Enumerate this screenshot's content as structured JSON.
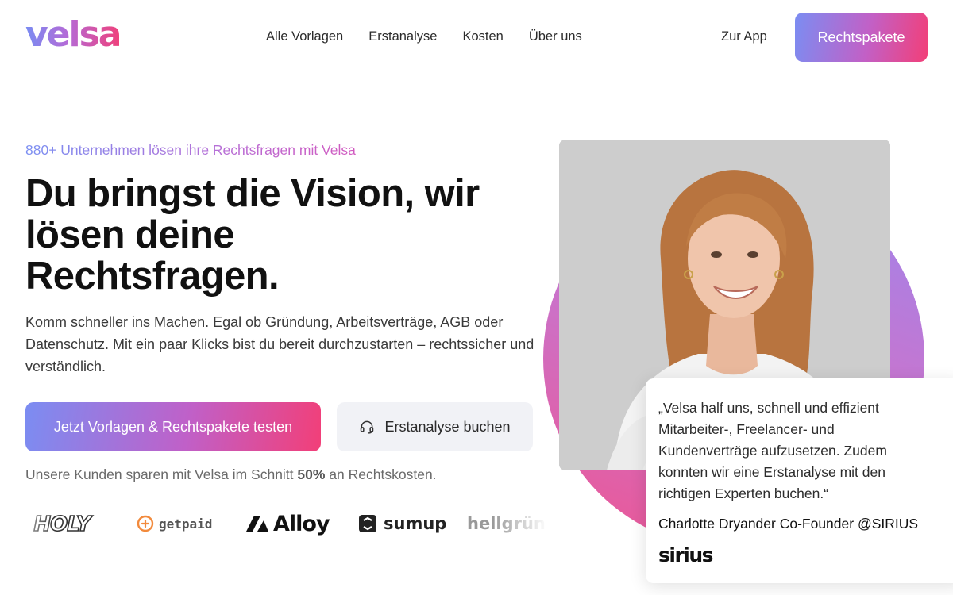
{
  "brand": {
    "name": "velsa"
  },
  "nav": {
    "links": [
      "Alle Vorlagen",
      "Erstanalyse",
      "Kosten",
      "Über uns"
    ],
    "app_link": "Zur App",
    "cta": "Rechtspakete"
  },
  "hero": {
    "eyebrow": "880+ Unternehmen lösen ihre Rechtsfragen mit Velsa",
    "headline_1": "Du bringst die Vision, wir",
    "headline_2": "lösen deine",
    "headline_3": "Rechtsfragen.",
    "subtext": "Komm schneller ins Machen. Egal ob Gründung, Arbeitsverträge, AGB oder Datenschutz. Mit ein paar Klicks bist du bereit durchzustarten – rechtssicher und verständlich.",
    "primary_button": "Jetzt Vorlagen & Rechtspakete testen",
    "secondary_button": "Erstanalyse buchen",
    "savings_prefix": "Unsere Kunden sparen mit Velsa im Schnitt",
    "savings_value": "50%",
    "savings_suffix": "an Rechtskosten."
  },
  "logos": {
    "holy": "HOLY",
    "getpaid": "getpaid",
    "alloy": "Alloy",
    "sumup": "sumup",
    "hellgruen": "hellgrün"
  },
  "testimonial": {
    "quote": "„Velsa half uns, schnell und effizient Mitarbeiter-, Freelancer- und Kundenverträge aufzusetzen. Zudem konnten wir eine Erstanalyse mit den richtigen Experten buchen.“",
    "author": "Charlotte Dryander Co-Founder @SIRIUS",
    "company_logo": "sirius"
  },
  "colors": {
    "gradient_start": "#7b8df2",
    "gradient_mid": "#c060c8",
    "gradient_end": "#f23f78",
    "secondary_button_bg": "#f1f2f6"
  }
}
